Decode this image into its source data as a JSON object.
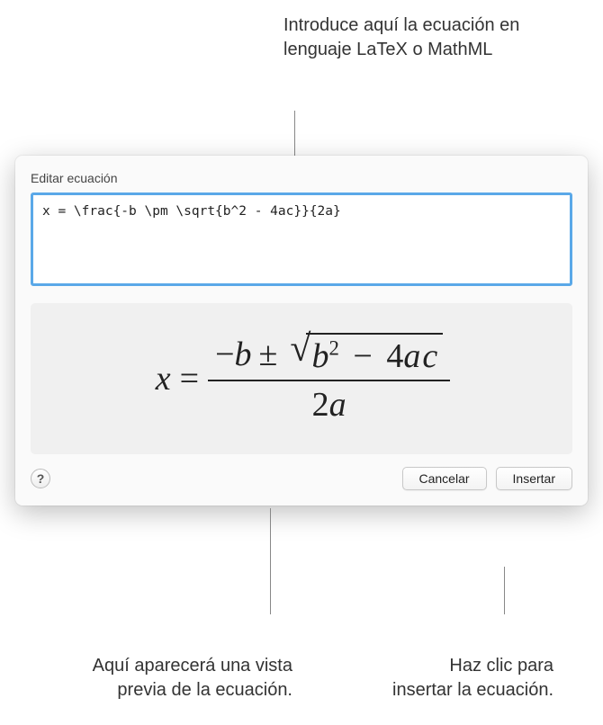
{
  "callouts": {
    "top": "Introduce aquí la ecuación en lenguaje LaTeX o MathML",
    "bottom_left": "Aquí aparecerá una vista previa de la ecuación.",
    "bottom_right": "Haz clic para insertar la ecuación."
  },
  "dialog": {
    "title": "Editar ecuación",
    "input_value": "x = \\frac{-b \\pm \\sqrt{b^2 - 4ac}}{2a}",
    "help_label": "?",
    "cancel_label": "Cancelar",
    "insert_label": "Insertar"
  },
  "preview": {
    "x": "x",
    "eq": "=",
    "minus": "−",
    "b": "b",
    "pm": "±",
    "b2": "b",
    "sup2": "2",
    "minus2": "−",
    "four": "4",
    "a": "a",
    "c": "c",
    "two": "2",
    "a2": "a"
  }
}
